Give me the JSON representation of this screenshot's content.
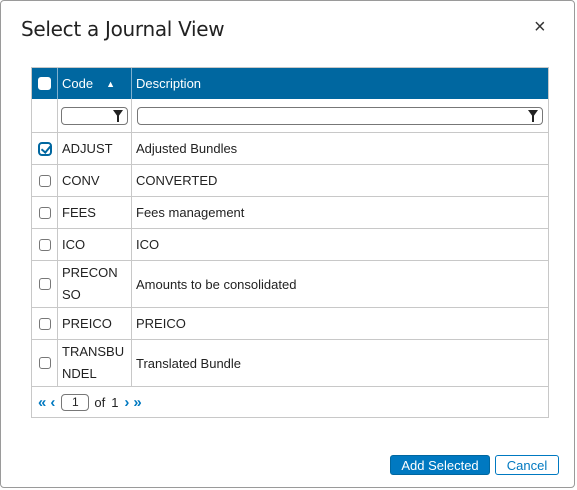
{
  "dialog": {
    "title": "Select a Journal View",
    "close_label": "×"
  },
  "grid": {
    "columns": {
      "code": "Code",
      "description": "Description"
    },
    "sort_indicator": "▲",
    "rows": [
      {
        "code": "ADJUST",
        "description": "Adjusted Bundles",
        "checked": true
      },
      {
        "code": "CONV",
        "description": "CONVERTED",
        "checked": false
      },
      {
        "code": "FEES",
        "description": "Fees management",
        "checked": false
      },
      {
        "code": "ICO",
        "description": "ICO",
        "checked": false
      },
      {
        "code_line1": "PRECON",
        "code_line2": "SO",
        "description": "Amounts to be consolidated",
        "checked": false
      },
      {
        "code": "PREICO",
        "description": "PREICO",
        "checked": false
      },
      {
        "code_line1": "TRANSBU",
        "code_line2": "NDEL",
        "description": "Translated Bundle",
        "checked": false
      }
    ]
  },
  "pager": {
    "first": "«",
    "prev": "‹",
    "page": "1",
    "of_label": "of",
    "total_pages": "1",
    "next": "›",
    "last": "»"
  },
  "buttons": {
    "add_selected": "Add Selected",
    "cancel": "Cancel"
  },
  "colors": {
    "header_bg": "#0067a0",
    "accent": "#0079c1"
  }
}
